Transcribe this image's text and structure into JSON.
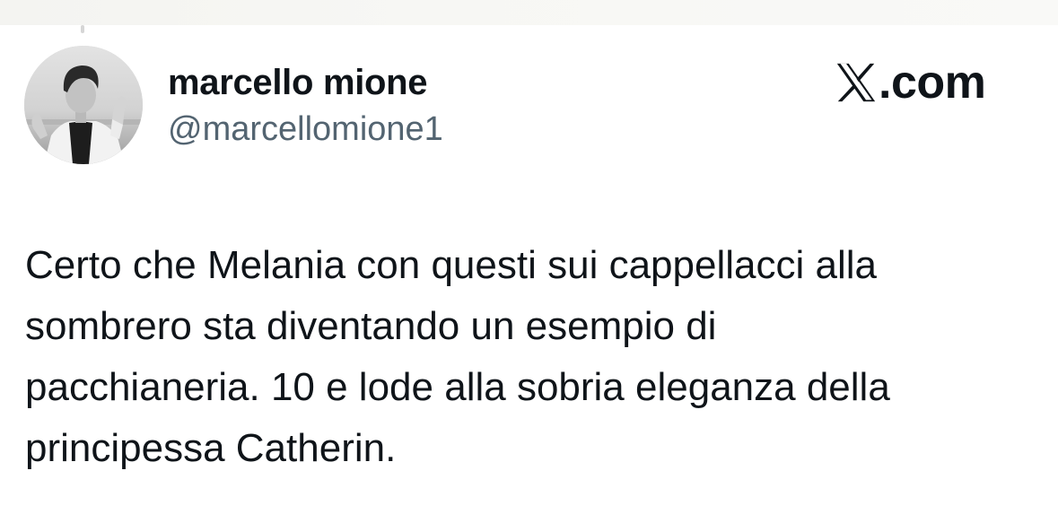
{
  "header": {
    "display_name": "marcello mione",
    "handle": "@marcellomione1",
    "avatar_icon": "profile-photo-avatar"
  },
  "brand": {
    "icon": "x-logo-icon",
    "text": ".com"
  },
  "tweet": {
    "lines": [
      "Certo che Melania con questi sui cappellacci alla",
      "sombrero sta diventando un esempio di",
      "pacchianeria. 10 e lode alla sobria eleganza della",
      "principessa Catherin."
    ]
  },
  "colors": {
    "text_primary": "#0f1419",
    "text_secondary": "#536471",
    "background": "#ffffff"
  }
}
